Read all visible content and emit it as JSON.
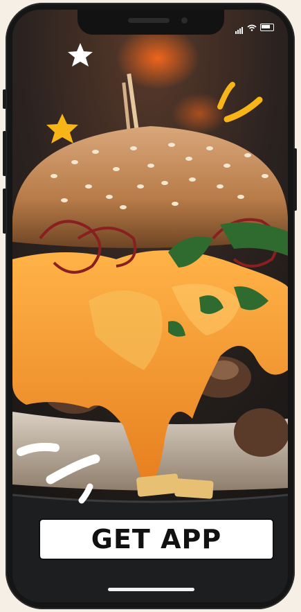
{
  "cta": {
    "label": "GET APP"
  },
  "status_bar": {
    "signal_icon": "signal-bars-icon",
    "wifi_icon": "wifi-icon",
    "battery_icon": "battery-icon"
  },
  "colors": {
    "accent_yellow": "#f7b518",
    "cheese": "#f39c2b",
    "bun": "#c98f59"
  }
}
